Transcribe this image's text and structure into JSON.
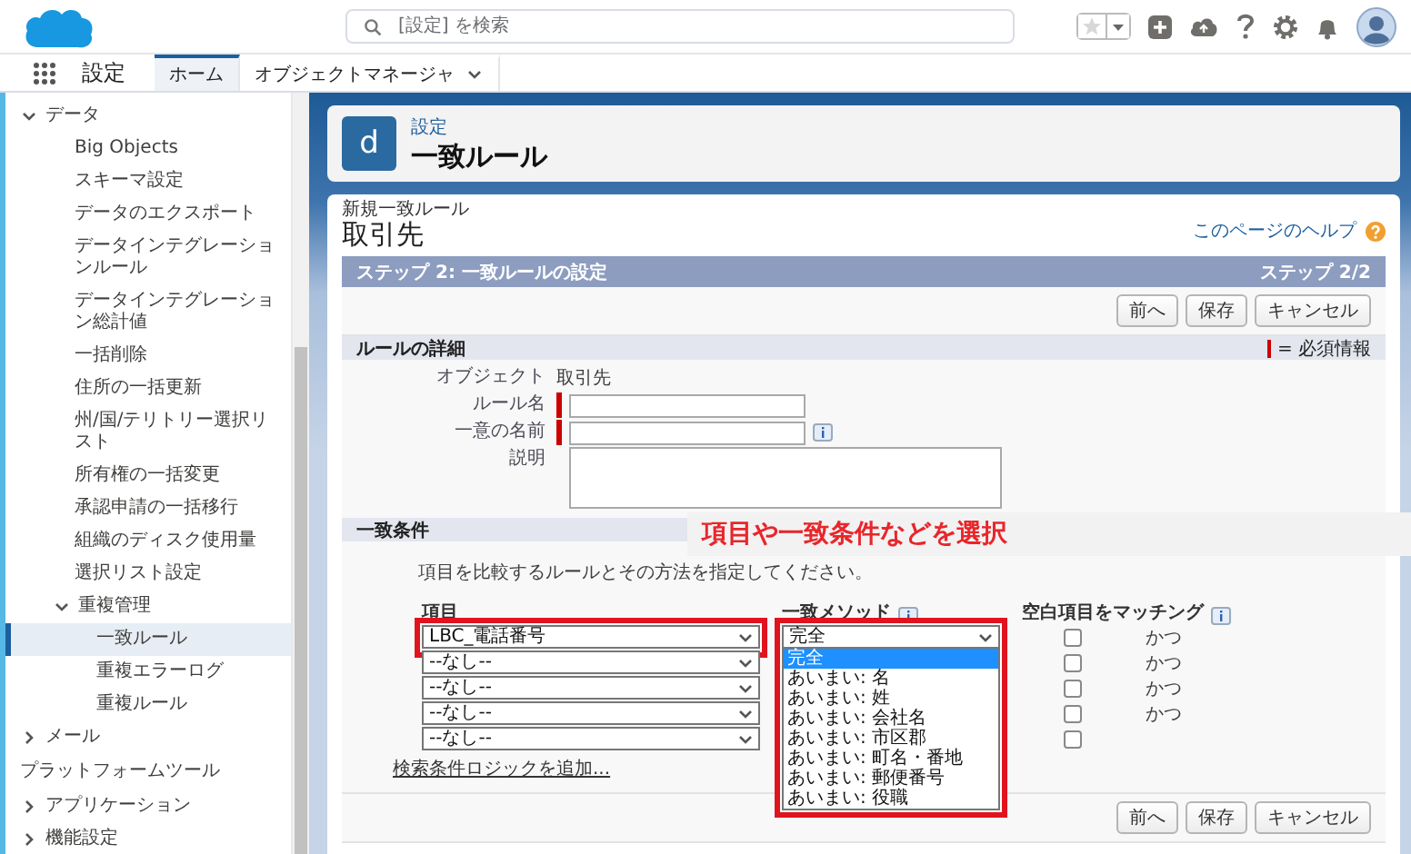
{
  "header": {
    "search": {
      "placeholder": "[設定] を検索"
    }
  },
  "nav": {
    "app_name": "設定",
    "tabs": [
      {
        "label": "ホーム",
        "selected": true,
        "menu": false
      },
      {
        "label": "オブジェクトマネージャ",
        "selected": false,
        "menu": true
      }
    ]
  },
  "sidebar": {
    "items": [
      {
        "kind": "group",
        "label": "データ",
        "expanded": true,
        "children": [
          {
            "kind": "link",
            "label": "Big Objects",
            "selected": false
          },
          {
            "kind": "link",
            "label": "スキーマ設定",
            "selected": false
          },
          {
            "kind": "link",
            "label": "データのエクスポート",
            "selected": false
          },
          {
            "kind": "link",
            "label": "データインテグレーションルール",
            "selected": false
          },
          {
            "kind": "link",
            "label": "データインテグレーション総計値",
            "selected": false
          },
          {
            "kind": "link",
            "label": "一括削除",
            "selected": false
          },
          {
            "kind": "link",
            "label": "住所の一括更新",
            "selected": false
          },
          {
            "kind": "link",
            "label": "州/国/テリトリー選択リスト",
            "selected": false
          },
          {
            "kind": "link",
            "label": "所有権の一括変更",
            "selected": false
          },
          {
            "kind": "link",
            "label": "承認申請の一括移行",
            "selected": false
          },
          {
            "kind": "link",
            "label": "組織のディスク使用量",
            "selected": false
          },
          {
            "kind": "link",
            "label": "選択リスト設定",
            "selected": false
          },
          {
            "kind": "group",
            "label": "重複管理",
            "expanded": true,
            "children": [
              {
                "kind": "link",
                "label": "一致ルール",
                "selected": true
              },
              {
                "kind": "link",
                "label": "重複エラーログ",
                "selected": false
              },
              {
                "kind": "link",
                "label": "重複ルール",
                "selected": false
              }
            ]
          }
        ]
      },
      {
        "kind": "group",
        "label": "メール",
        "expanded": false
      },
      {
        "kind": "heading",
        "label": "プラットフォームツール"
      },
      {
        "kind": "group",
        "label": "アプリケーション",
        "expanded": false
      },
      {
        "kind": "group",
        "label": "機能設定",
        "expanded": false
      }
    ]
  },
  "page_header": {
    "icon_letter": "d",
    "breadcrumb": "設定",
    "title": "一致ルール"
  },
  "page": {
    "subtitle": "新規一致ルール",
    "title": "取引先",
    "help_link": "このページのヘルプ",
    "step_title": "ステップ 2: 一致ルールの設定",
    "step_count": "ステップ 2/2",
    "top_buttons": [
      "前へ",
      "保存",
      "キャンセル"
    ],
    "bottom_buttons": [
      "前へ",
      "保存",
      "キャンセル"
    ]
  },
  "rule_details": {
    "heading": "ルールの詳細",
    "required_legend": "= 必須情報",
    "fields": [
      {
        "label": "オブジェクト",
        "kind": "text",
        "value": "取引先"
      },
      {
        "label": "ルール名",
        "kind": "input",
        "required": true,
        "info": false
      },
      {
        "label": "一意の名前",
        "kind": "input",
        "required": true,
        "info": true
      },
      {
        "label": "説明",
        "kind": "textarea",
        "required": false,
        "info": false
      }
    ]
  },
  "criteria": {
    "heading": "一致条件",
    "instruction": "項目を比較するルールとその方法を指定してください。",
    "columns": [
      {
        "label": "項目",
        "info": false
      },
      {
        "label": "一致メソッド",
        "info": true
      },
      {
        "label": "空白項目をマッチング",
        "info": true
      }
    ],
    "rows": [
      {
        "field": "LBC_電話番号",
        "highlighted": true,
        "match_blank": false,
        "connector": "かつ"
      },
      {
        "field": "--なし--",
        "highlighted": false,
        "match_blank": false,
        "connector": "かつ"
      },
      {
        "field": "--なし--",
        "highlighted": false,
        "match_blank": false,
        "connector": "かつ"
      },
      {
        "field": "--なし--",
        "highlighted": false,
        "match_blank": false,
        "connector": "かつ"
      },
      {
        "field": "--なし--",
        "highlighted": false,
        "match_blank": false
      }
    ],
    "method": {
      "value": "完全",
      "highlighted": true,
      "expanded": true,
      "options": [
        {
          "label": "完全",
          "selected": true
        },
        {
          "label": "あいまい: 名",
          "selected": false
        },
        {
          "label": "あいまい: 姓",
          "selected": false
        },
        {
          "label": "あいまい: 会社名",
          "selected": false
        },
        {
          "label": "あいまい: 市区郡",
          "selected": false
        },
        {
          "label": "あいまい: 町名・番地",
          "selected": false
        },
        {
          "label": "あいまい: 郵便番号",
          "selected": false
        },
        {
          "label": "あいまい: 役職",
          "selected": false
        }
      ]
    },
    "add_logic_link": "検索条件ロジックを追加..."
  },
  "annotation": {
    "text": "項目や一致条件などを選択"
  }
}
